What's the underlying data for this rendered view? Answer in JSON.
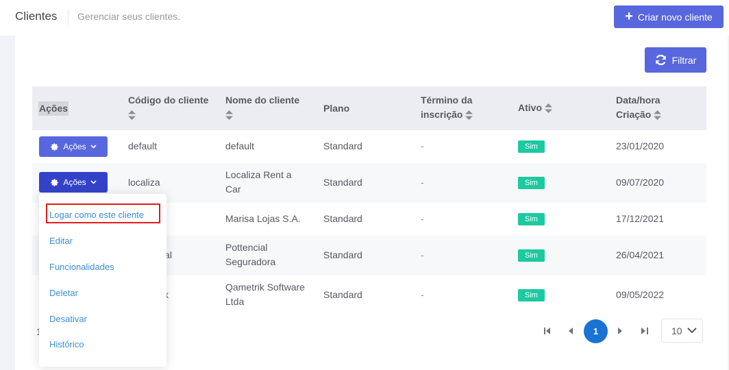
{
  "header": {
    "title": "Clientes",
    "subtitle": "Gerenciar seus clientes.",
    "new_button": "Criar novo cliente"
  },
  "toolbar": {
    "filter_label": "Filtrar"
  },
  "table": {
    "columns": {
      "actions": "Ações",
      "code": "Código do cliente",
      "name": "Nome do cliente",
      "plan": "Plano",
      "end": "Término da inscrição",
      "active": "Ativo",
      "created": "Data/hora Criação"
    },
    "action_button_label": "Ações",
    "rows": [
      {
        "code": "default",
        "name": "default",
        "plan": "Standard",
        "end": "-",
        "active": "Sim",
        "created": "23/01/2020"
      },
      {
        "code": "localiza",
        "name": "Localiza Rent a Car",
        "plan": "Standard",
        "end": "-",
        "active": "Sim",
        "created": "09/07/2020"
      },
      {
        "code": "",
        "name": "Marisa Lojas S.A.",
        "plan": "Standard",
        "end": "-",
        "active": "Sim",
        "created": "17/12/2021"
      },
      {
        "code": "ial",
        "name": "Pottencial Seguradora",
        "plan": "Standard",
        "end": "-",
        "active": "Sim",
        "created": "26/04/2021"
      },
      {
        "code": "k",
        "name": "Qametrik Software Ltda",
        "plan": "Standard",
        "end": "-",
        "active": "Sim",
        "created": "09/05/2022"
      }
    ]
  },
  "dropdown": {
    "items": [
      "Logar como este cliente",
      "Editar",
      "Funcionalidades",
      "Deletar",
      "Desativar",
      "Histórico"
    ]
  },
  "pagination": {
    "current_page": "1",
    "page_size": "10",
    "footer_partial": "1"
  },
  "colors": {
    "primary": "#5867dd",
    "success": "#1dc9a0",
    "link": "#3c8fd8",
    "highlight": "#e11c1c",
    "page_active": "#1a73d3"
  }
}
